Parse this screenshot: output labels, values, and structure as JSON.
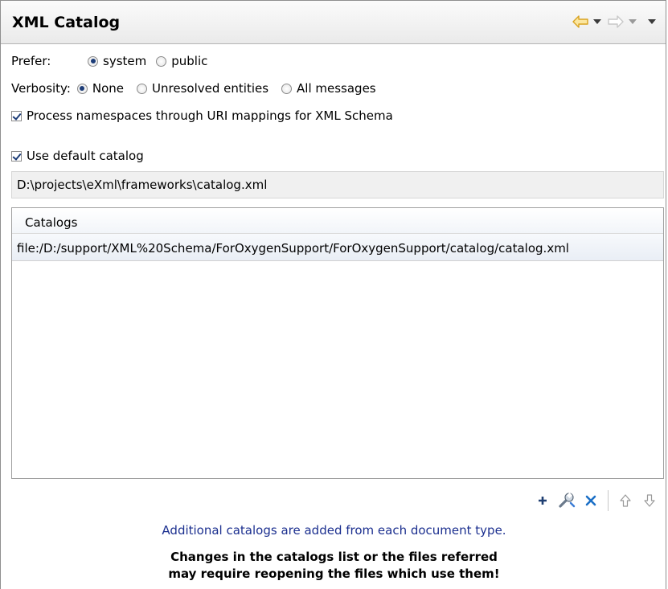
{
  "header": {
    "title": "XML Catalog"
  },
  "prefer": {
    "label": "Prefer:",
    "options": [
      "system",
      "public"
    ],
    "selected": "system"
  },
  "verbosity": {
    "label": "Verbosity:",
    "options": [
      "None",
      "Unresolved entities",
      "All messages"
    ],
    "selected": "None"
  },
  "process_namespaces": {
    "label": "Process namespaces through URI mappings for XML Schema",
    "checked": true
  },
  "use_default_catalog": {
    "label": "Use default catalog",
    "checked": true
  },
  "default_catalog_path": "D:\\projects\\eXml\\frameworks\\catalog.xml",
  "catalogs_table": {
    "header": "Catalogs",
    "rows": [
      "file:/D:/support/XML%20Schema/ForOxygenSupport/ForOxygenSupport/catalog/catalog.xml"
    ]
  },
  "toolbar": {
    "icons": [
      "add-icon",
      "edit-icon",
      "remove-icon",
      "move-up-icon",
      "move-down-icon"
    ]
  },
  "info_text": "Additional catalogs are added from each document type.",
  "warning_lines": [
    "Changes in the catalogs list or the files referred",
    "may require reopening the files which use them!"
  ],
  "colors": {
    "info_text": "#1b2f8f",
    "back_arrow": "#e8b830",
    "radio_dot": "#1d3d78"
  }
}
